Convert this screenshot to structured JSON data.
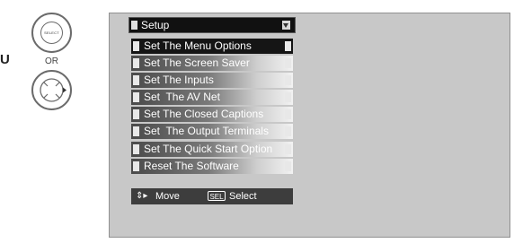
{
  "left_edge_text": "U",
  "remote": {
    "select_label": "SELECT",
    "or_text": "OR"
  },
  "menu": {
    "title": "Setup",
    "items": [
      {
        "label": "Set The Menu Options"
      },
      {
        "label": "Set The Screen Saver"
      },
      {
        "label": "Set The Inputs"
      },
      {
        "label": "Set  The AV Net"
      },
      {
        "label": "Set The Closed Captions"
      },
      {
        "label": "Set  The Output Terminals"
      },
      {
        "label": "Set The Quick Start Option"
      },
      {
        "label": "Reset The Software"
      }
    ],
    "footer": {
      "move_label": "Move",
      "sel_badge": "SEL",
      "select_label": "Select"
    }
  }
}
